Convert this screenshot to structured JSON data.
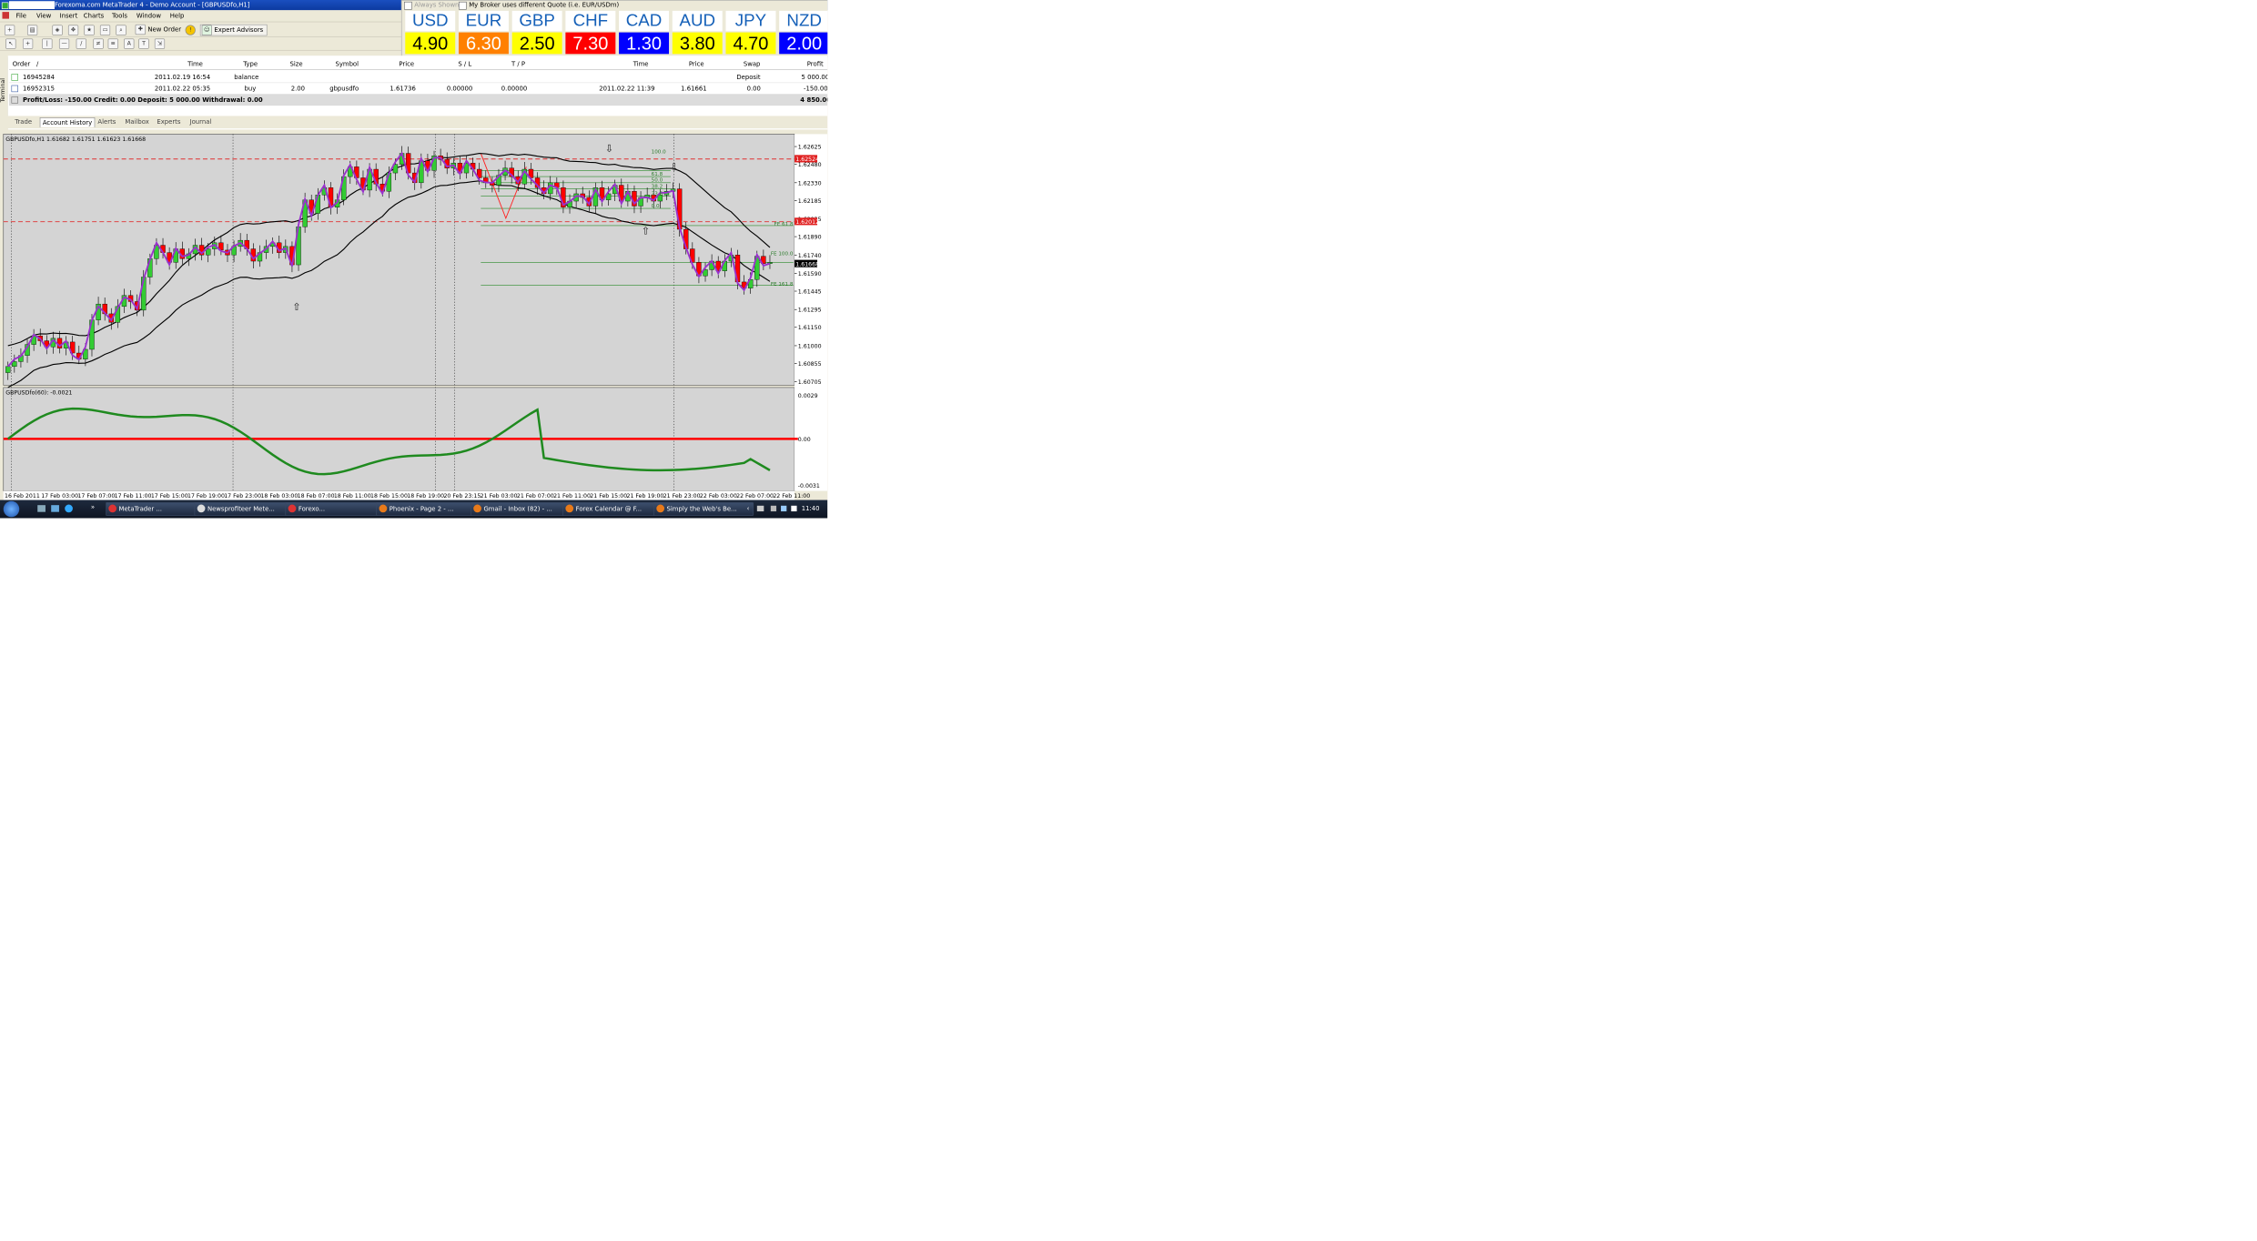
{
  "titlebar": {
    "title": "Forexoma.com MetaTrader 4 - Demo Account - [GBPUSDfo,H1]"
  },
  "menu": [
    "File",
    "View",
    "Insert",
    "Charts",
    "Tools",
    "Window",
    "Help"
  ],
  "toolbar": {
    "new_order": "New Order",
    "expert_advisors": "Expert Advisors"
  },
  "currency_panel": {
    "always_shown": "Always Shown",
    "broker_note": "My Broker uses different Quote (i.e. EUR/USDm)",
    "items": [
      {
        "name": "USD",
        "value": "4.90",
        "color": "#ffff00"
      },
      {
        "name": "EUR",
        "value": "6.30",
        "color": "#ff8000"
      },
      {
        "name": "GBP",
        "value": "2.50",
        "color": "#ffff00"
      },
      {
        "name": "CHF",
        "value": "7.30",
        "color": "#ff0000"
      },
      {
        "name": "CAD",
        "value": "1.30",
        "color": "#0000ff"
      },
      {
        "name": "AUD",
        "value": "3.80",
        "color": "#ffff00"
      },
      {
        "name": "JPY",
        "value": "4.70",
        "color": "#ffff00"
      },
      {
        "name": "NZD",
        "value": "2.00",
        "color": "#0000ff"
      }
    ]
  },
  "terminal": {
    "side_label": "Terminal",
    "headers": [
      "Order",
      "/",
      "Time",
      "Type",
      "Size",
      "Symbol",
      "Price",
      "S / L",
      "T / P",
      "Time",
      "Price",
      "Swap",
      "Profit"
    ],
    "rows": [
      {
        "order": "16945284",
        "time": "2011.02.19 16:54",
        "type": "balance",
        "size": "",
        "symbol": "",
        "price": "",
        "sl": "",
        "tp": "",
        "ctime": "",
        "cprice": "",
        "swap": "Deposit",
        "profit": "5 000.00"
      },
      {
        "order": "16952315",
        "time": "2011.02.22 05:35",
        "type": "buy",
        "size": "2.00",
        "symbol": "gbpusdfo",
        "price": "1.61736",
        "sl": "0.00000",
        "tp": "0.00000",
        "ctime": "2011.02.22 11:39",
        "cprice": "1.61661",
        "swap": "0.00",
        "profit": "-150.00"
      }
    ],
    "summary": "Profit/Loss: -150.00   Credit: 0.00   Deposit: 5 000.00   Withdrawal: 0.00",
    "summary_total": "4 850.00",
    "tabs": [
      "Trade",
      "Account History",
      "Alerts",
      "Mailbox",
      "Experts",
      "Journal"
    ]
  },
  "chart": {
    "header": "GBPUSDfo,H1  1.61682 1.61751 1.61623 1.61668",
    "indicator_header": "GBPUSDfo(60): -0.0021",
    "price_labels": [
      "1.62625",
      "1.62480",
      "1.62330",
      "1.62185",
      "1.62035",
      "1.61890",
      "1.61740",
      "1.61590",
      "1.61445",
      "1.61295",
      "1.61150",
      "1.61000",
      "1.60855",
      "1.60705"
    ],
    "indicator_labels": [
      "0.0029",
      "0.00",
      "-0.0031"
    ],
    "time_labels": [
      "16 Feb 2011",
      "17 Feb 03:00",
      "17 Feb 07:00",
      "17 Feb 11:00",
      "17 Feb 15:00",
      "17 Feb 19:00",
      "17 Feb 23:00",
      "18 Feb 03:00",
      "18 Feb 07:00",
      "18 Feb 11:00",
      "18 Feb 15:00",
      "18 Feb 19:00",
      "20 Feb 23:15",
      "21 Feb 03:00",
      "21 Feb 07:00",
      "21 Feb 11:00",
      "21 Feb 15:00",
      "21 Feb 19:00",
      "21 Feb 23:00",
      "22 Feb 03:00",
      "22 Feb 07:00",
      "22 Feb 11:00"
    ],
    "fib_labels": [
      "100.0",
      "61.8",
      "50.0",
      "38.2",
      "23.6",
      "0.0"
    ],
    "fe_labels": [
      "FE 61.8",
      "FE 100.0",
      "FE 161.8"
    ],
    "tag_labels": [
      "1.62524",
      "1.62012",
      "1.61668"
    ],
    "colors": {
      "bull": "#33cc33",
      "bear": "#ff0000",
      "ma": "#9932cc",
      "band": "#000000",
      "osc": "#1f8a1f",
      "zero": "#ff0000",
      "bg": "#d4d4d4"
    }
  },
  "chart_data": {
    "type": "candlestick",
    "symbol": "GBPUSDfo",
    "timeframe": "H1",
    "ylim": [
      1.60705,
      1.62625
    ],
    "close": [
      1.6083,
      1.6087,
      1.6092,
      1.6101,
      1.6108,
      1.6104,
      1.6099,
      1.6106,
      1.6098,
      1.6103,
      1.6094,
      1.6089,
      1.6097,
      1.6121,
      1.6134,
      1.6126,
      1.6119,
      1.6132,
      1.6141,
      1.6136,
      1.6129,
      1.6156,
      1.6171,
      1.6182,
      1.6176,
      1.6168,
      1.6179,
      1.6171,
      1.6175,
      1.6182,
      1.6174,
      1.6179,
      1.6184,
      1.6178,
      1.6174,
      1.6181,
      1.6186,
      1.6179,
      1.6169,
      1.6176,
      1.6181,
      1.6184,
      1.6176,
      1.6181,
      1.6166,
      1.6197,
      1.6219,
      1.6208,
      1.6223,
      1.6229,
      1.6213,
      1.6219,
      1.6238,
      1.6246,
      1.6237,
      1.6227,
      1.6244,
      1.6232,
      1.6226,
      1.6241,
      1.6248,
      1.6257,
      1.6241,
      1.6233,
      1.6251,
      1.6243,
      1.6255,
      1.6252,
      1.6245,
      1.6249,
      1.6241,
      1.6249,
      1.6244,
      1.6237,
      1.6233,
      1.6231,
      1.6239,
      1.6245,
      1.6238,
      1.6232,
      1.6244,
      1.6237,
      1.6229,
      1.6224,
      1.6233,
      1.6229,
      1.6213,
      1.6218,
      1.6224,
      1.6221,
      1.6214,
      1.6229,
      1.6219,
      1.6224,
      1.6231,
      1.6218,
      1.6226,
      1.6214,
      1.6221,
      1.6223,
      1.6218,
      1.6223,
      1.6226,
      1.6228,
      1.6195,
      1.6179,
      1.6168,
      1.6157,
      1.6162,
      1.6169,
      1.6161,
      1.6169,
      1.6174,
      1.6152,
      1.6147,
      1.6154,
      1.6173,
      1.6167,
      1.6168
    ],
    "indicator": {
      "name": "GBPUSDfo(60)",
      "last": -0.0021,
      "ylim": [
        -0.0031,
        0.0029
      ]
    }
  },
  "taskbar": {
    "buttons": [
      {
        "label": "MetaTrader ...",
        "icon": "#d33"
      },
      {
        "label": "Newsprofiteer Mete...",
        "icon": "#ddd"
      },
      {
        "label": "Forexo...",
        "icon": "#d33"
      },
      {
        "label": "Phoenix - Page 2 - ...",
        "icon": "#e87a1a"
      },
      {
        "label": "Gmail - Inbox (82) - ...",
        "icon": "#e87a1a"
      },
      {
        "label": "Forex Calendar @ F...",
        "icon": "#e87a1a"
      },
      {
        "label": "Simply the Web's Be...",
        "icon": "#e87a1a"
      }
    ],
    "clock": "11:40"
  }
}
